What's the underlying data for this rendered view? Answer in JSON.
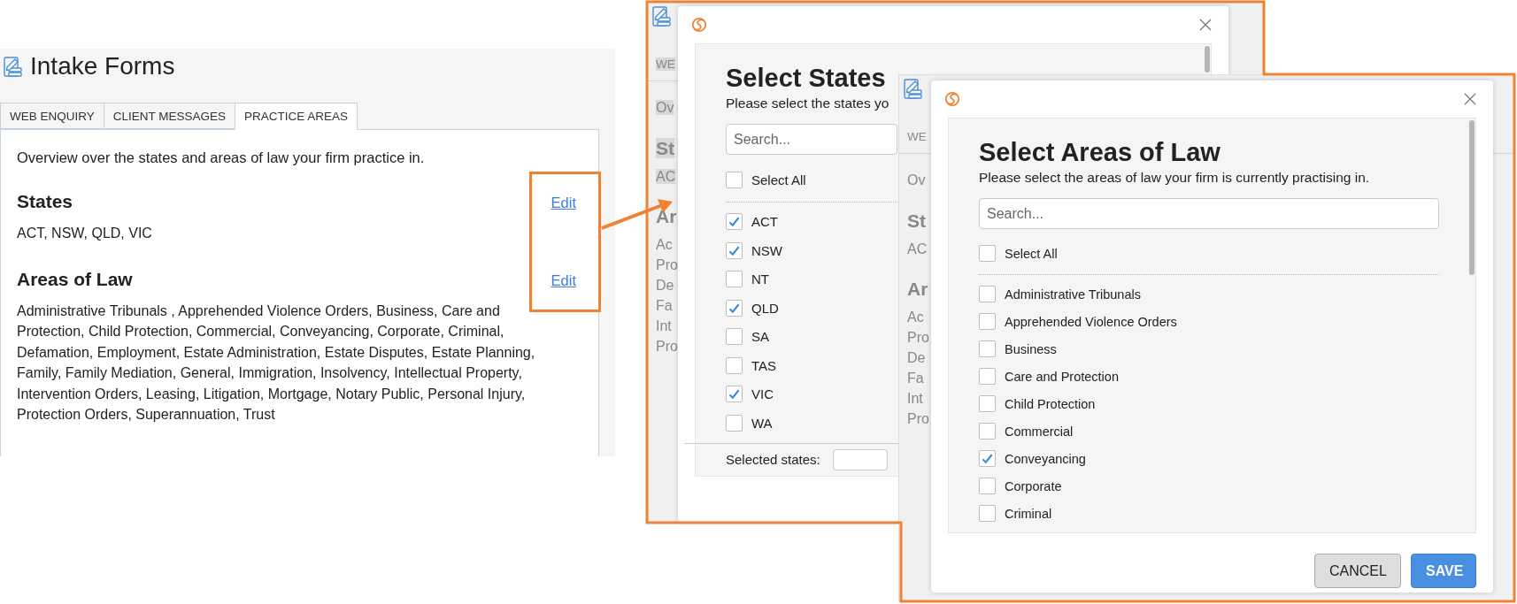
{
  "main": {
    "title": "Intake Forms",
    "tabs": [
      {
        "label": "WEB ENQUIRY",
        "selected": false
      },
      {
        "label": "CLIENT MESSAGES",
        "selected": false
      },
      {
        "label": "PRACTICE AREAS",
        "selected": true
      }
    ],
    "intro": "Overview over the states and areas of law your firm practice in.",
    "sections": [
      {
        "heading": "States",
        "link": "Edit",
        "text": "ACT, NSW, QLD, VIC"
      },
      {
        "heading": "Areas of Law",
        "link": "Edit",
        "text": "Administrative Tribunals , Apprehended Violence Orders, Business, Care and Protection, Child Protection, Commercial, Conveyancing, Corporate, Criminal, Defamation, Employment, Estate Administration, Estate Disputes, Estate Planning, Family, Family Mediation, General, Immigration, Insolvency, Intellectual Property, Intervention Orders, Leasing, Litigation, Mortgage, Notary Public, Personal Injury, Protection Orders, Superannuation, Trust"
      }
    ]
  },
  "background_windows": [
    {
      "tab": "WE",
      "tab_highlighted": true,
      "lines": [
        {
          "text": "Ov",
          "kind": "intro",
          "highlighted": true
        },
        {
          "text": "St",
          "kind": "heading",
          "highlighted": true
        },
        {
          "text": "AC",
          "kind": "text",
          "highlighted": true
        },
        {
          "text": "Ar",
          "kind": "heading",
          "highlighted": false
        },
        {
          "text": "Ac",
          "kind": "text",
          "highlighted": false
        },
        {
          "text": "Pro",
          "kind": "text",
          "highlighted": false
        },
        {
          "text": "De",
          "kind": "text",
          "highlighted": false
        },
        {
          "text": "Fa",
          "kind": "text",
          "highlighted": false
        },
        {
          "text": "Int",
          "kind": "text",
          "highlighted": false
        },
        {
          "text": "Pro",
          "kind": "text",
          "highlighted": false
        }
      ]
    },
    {
      "tab": "WE",
      "tab_highlighted": false,
      "lines": [
        {
          "text": "Ov",
          "kind": "intro",
          "highlighted": false
        },
        {
          "text": "St",
          "kind": "heading",
          "highlighted": false
        },
        {
          "text": "AC",
          "kind": "text",
          "highlighted": false
        },
        {
          "text": "Ar",
          "kind": "heading",
          "highlighted": false
        },
        {
          "text": "Ac",
          "kind": "text",
          "highlighted": false
        },
        {
          "text": "Pro",
          "kind": "text",
          "highlighted": false
        },
        {
          "text": "De",
          "kind": "text",
          "highlighted": false
        },
        {
          "text": "Fa",
          "kind": "text",
          "highlighted": false
        },
        {
          "text": "Int",
          "kind": "text",
          "highlighted": false
        },
        {
          "text": "Pro",
          "kind": "text",
          "highlighted": false
        }
      ]
    }
  ],
  "states_dialog": {
    "title": "Select States",
    "subtitle": "Please select the states yo",
    "search": {
      "placeholder": "Search..."
    },
    "select_all": {
      "label": "Select All",
      "checked": false
    },
    "items": [
      {
        "label": "ACT",
        "checked": true
      },
      {
        "label": "NSW",
        "checked": true
      },
      {
        "label": "NT",
        "checked": false
      },
      {
        "label": "QLD",
        "checked": true
      },
      {
        "label": "SA",
        "checked": false
      },
      {
        "label": "TAS",
        "checked": false
      },
      {
        "label": "VIC",
        "checked": true
      },
      {
        "label": "WA",
        "checked": false
      }
    ],
    "footer_label": "Selected states:"
  },
  "areas_dialog": {
    "title": "Select Areas of Law",
    "subtitle": "Please select the areas of law your firm is currently practising in.",
    "search": {
      "placeholder": "Search..."
    },
    "select_all": {
      "label": "Select All",
      "checked": false
    },
    "items": [
      {
        "label": "Administrative Tribunals",
        "checked": false
      },
      {
        "label": "Apprehended Violence Orders",
        "checked": false
      },
      {
        "label": "Business",
        "checked": false
      },
      {
        "label": "Care and Protection",
        "checked": false
      },
      {
        "label": "Child Protection",
        "checked": false
      },
      {
        "label": "Commercial",
        "checked": false
      },
      {
        "label": "Conveyancing",
        "checked": true
      },
      {
        "label": "Corporate",
        "checked": false
      },
      {
        "label": "Criminal",
        "checked": false
      }
    ],
    "buttons": [
      {
        "label": "CANCEL",
        "kind": "secondary"
      },
      {
        "label": "SAVE",
        "kind": "primary"
      }
    ]
  }
}
